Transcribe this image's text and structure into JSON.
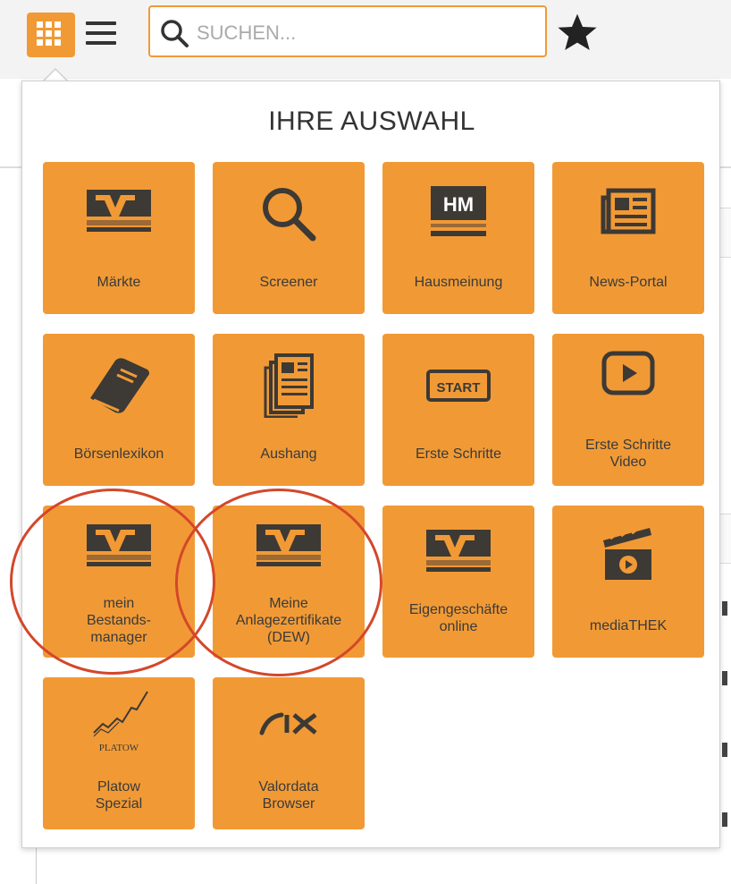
{
  "toolbar": {
    "search_placeholder": "SUCHEN...",
    "icons": [
      "grid-icon",
      "menu-icon",
      "search-icon",
      "star-icon"
    ]
  },
  "popup": {
    "title": "IHRE AUSWAHL",
    "tiles": [
      {
        "label": "Märkte",
        "icon": "vr-logo-icon"
      },
      {
        "label": "Screener",
        "icon": "magnifier-icon"
      },
      {
        "label": "Hausmeinung",
        "icon": "hm-logo-icon"
      },
      {
        "label": "News-Portal",
        "icon": "newspaper-icon"
      },
      {
        "label": "Börsenlexikon",
        "icon": "book-icon"
      },
      {
        "label": "Aushang",
        "icon": "document-icon"
      },
      {
        "label": "Erste Schritte",
        "icon": "start-icon"
      },
      {
        "label": "Erste Schritte\nVideo",
        "icon": "play-icon"
      },
      {
        "label": "mein\nBestands-\nmanager",
        "icon": "vr-logo-icon"
      },
      {
        "label": "Meine\nAnlagezertifikate\n(DEW)",
        "icon": "vr-logo-icon"
      },
      {
        "label": "Eigengeschäfte\nonline",
        "icon": "vr-logo-icon"
      },
      {
        "label": "mediaTHEK",
        "icon": "clapperboard-icon"
      },
      {
        "label": "Platow\nSpezial",
        "icon": "platow-logo-icon",
        "icon_text": "PLATOW"
      },
      {
        "label": "Valordata\nBrowser",
        "icon": "six-logo-icon"
      }
    ]
  },
  "colors": {
    "accent": "#f19a35",
    "icon_dark": "#3d3935",
    "highlight_ring": "#d4472a"
  }
}
